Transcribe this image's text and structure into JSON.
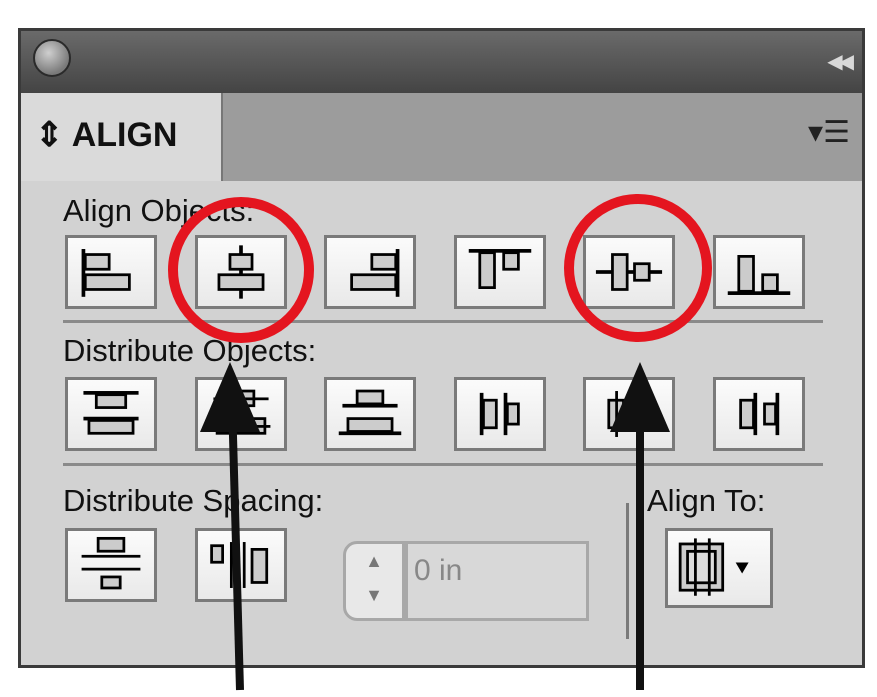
{
  "panel": {
    "tab_label": "ALIGN",
    "tab_icon": "updown-arrows-icon",
    "menu_icon": "panel-menu-icon"
  },
  "align_objects": {
    "label": "Align Objects:",
    "buttons": [
      "align-left-edges",
      "align-horizontal-centers",
      "align-right-edges",
      "align-top-edges",
      "align-vertical-centers",
      "align-bottom-edges"
    ]
  },
  "distribute_objects": {
    "label": "Distribute Objects:",
    "buttons": [
      "distribute-top-edges",
      "distribute-vertical-centers",
      "distribute-bottom-edges",
      "distribute-left-edges",
      "distribute-horizontal-centers",
      "distribute-right-edges"
    ]
  },
  "distribute_spacing": {
    "label": "Distribute Spacing:",
    "buttons": [
      "vertical-distribute-space",
      "horizontal-distribute-space"
    ],
    "value": "0 in"
  },
  "align_to": {
    "label": "Align To:",
    "icon": "align-to-selection-icon"
  },
  "annotations": {
    "color": "#e4151f",
    "arrow_color": "#111111"
  }
}
